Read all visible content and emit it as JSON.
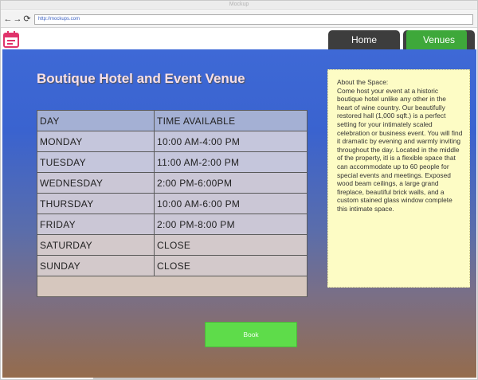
{
  "window": {
    "title": "Mockup"
  },
  "browser": {
    "url": "http://mockups.com"
  },
  "nav": {
    "tabs": [
      {
        "label": "Home"
      },
      {
        "label": "Venues"
      }
    ]
  },
  "page": {
    "title": "Boutique Hotel and Event Venue",
    "schedule": {
      "headers": [
        "DAY",
        "TIME AVAILABLE"
      ],
      "rows": [
        [
          "MONDAY",
          "10:00 AM-4:00 PM"
        ],
        [
          "TUESDAY",
          "11:00 AM-2:00 PM"
        ],
        [
          "WEDNESDAY",
          "2:00 PM-6:00PM"
        ],
        [
          "THURSDAY",
          "10:00 AM-6:00 PM"
        ],
        [
          "FRIDAY",
          "2:00 PM-8:00 PM"
        ],
        [
          "SATURDAY",
          "CLOSE"
        ],
        [
          "SUNDAY",
          "CLOSE"
        ]
      ]
    },
    "about": {
      "heading": "About the Space:",
      "body": "Come host your event at a historic boutique hotel unlike any other in the heart of wine country.   Our beautifully restored hall (1,000 sqft.) is a perfect setting for your intimately scaled celebration or business event. You will find it dramatic by evening and warmly inviting throughout the day.",
      "body2": "Located in the middle of the property, itl is a flexible space that can accommodate up to 60 people for special events and meetings. Exposed wood beam ceilings, a large grand fireplace, beautiful brick walls, and a custom stained glass window complete this intimate space."
    },
    "book_label": "Book"
  },
  "colors": {
    "accent_green": "#3ea83a",
    "book_green": "#5edc4a",
    "app_icon_pink": "#e0336b"
  }
}
